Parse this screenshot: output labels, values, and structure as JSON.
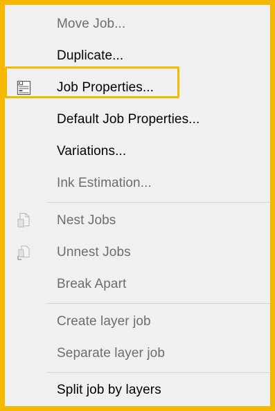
{
  "menu": {
    "items": [
      {
        "label": "Move Job...",
        "enabled": false,
        "icon": null
      },
      {
        "label": "Duplicate...",
        "enabled": true,
        "icon": null
      },
      {
        "label": "Job Properties...",
        "enabled": true,
        "icon": "job-properties-icon",
        "highlighted": true
      },
      {
        "label": "Default Job Properties...",
        "enabled": true,
        "icon": null
      },
      {
        "label": "Variations...",
        "enabled": true,
        "icon": null
      },
      {
        "label": "Ink Estimation...",
        "enabled": false,
        "icon": null
      },
      {
        "label": "Nest Jobs",
        "enabled": false,
        "icon": "nest-jobs-icon"
      },
      {
        "label": "Unnest Jobs",
        "enabled": false,
        "icon": "unnest-jobs-icon"
      },
      {
        "label": "Break Apart",
        "enabled": false,
        "icon": null
      },
      {
        "label": "Create layer job",
        "enabled": false,
        "icon": null
      },
      {
        "label": "Separate layer job",
        "enabled": false,
        "icon": null
      },
      {
        "label": "Split job by layers",
        "enabled": true,
        "icon": null
      }
    ]
  },
  "colors": {
    "highlight_border": "#f5b800",
    "menu_background": "#f0f0f0",
    "enabled_text": "#000000",
    "disabled_text": "#6d6d6d"
  }
}
